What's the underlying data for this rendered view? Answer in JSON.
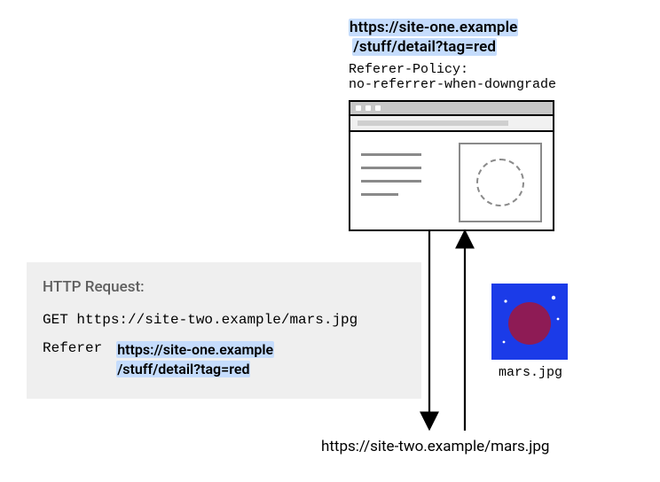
{
  "top_url_line1": "https://site-one.example",
  "top_url_line2": "/stuff/detail?tag=red",
  "policy_line1": "Referer-Policy:",
  "policy_line2": "no-referrer-when-downgrade",
  "request": {
    "title": "HTTP Request:",
    "get_line": "GET https://site-two.example/mars.jpg",
    "referer_label": "Referer",
    "referer_value_line1": "https://site-one.example",
    "referer_value_line2": "/stuff/detail?tag=red"
  },
  "mars_label": "mars.jpg",
  "bottom_url": "https://site-two.example/mars.jpg"
}
